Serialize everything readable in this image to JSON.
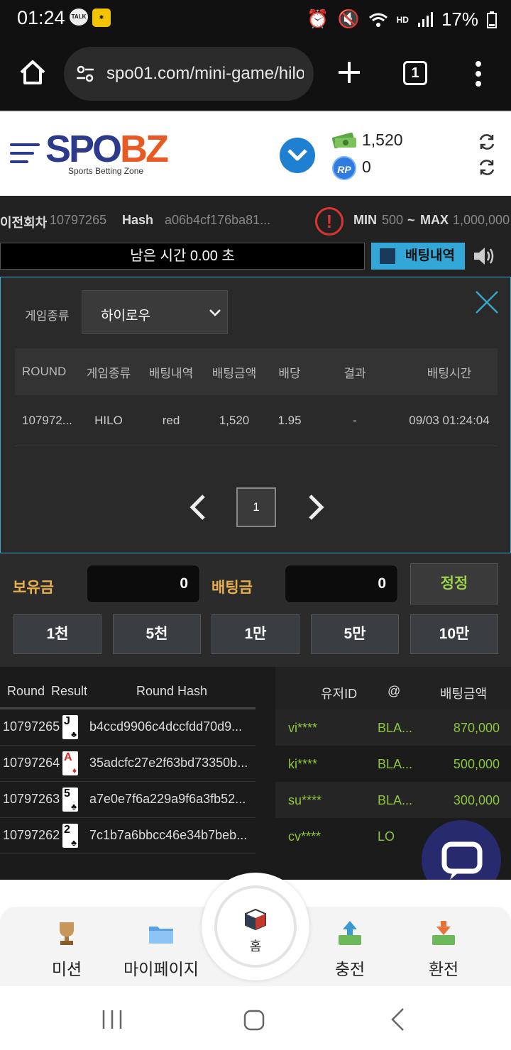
{
  "status_bar": {
    "time": "01:24",
    "talk_badge": "TALK",
    "battery": "17%"
  },
  "browser": {
    "url": "spo01.com/mini-game/hilo",
    "tab_count": "1"
  },
  "header": {
    "logo_main_left": "SPO",
    "logo_main_right": "BZ",
    "logo_sub": "Sports Betting Zone",
    "balance": "1,520",
    "rp_label": "RP",
    "rp_balance": "0"
  },
  "game_info": {
    "prev_round_label": "이전회차",
    "prev_round_value": "10797265",
    "hash_label": "Hash",
    "hash_value": "a06b4cf176ba81...",
    "min_label": "MIN",
    "min_value": "500",
    "tilde": "~",
    "max_label": "MAX",
    "max_value": "1,000,000",
    "timer_text": "남은 시간 0.00 초",
    "bet_history_button": "배팅내역"
  },
  "history_panel": {
    "game_type_label": "게임종류",
    "game_type_value": "하이로우",
    "columns": [
      "ROUND",
      "게임종류",
      "배팅내역",
      "배팅금액",
      "배당",
      "결과",
      "배팅시간"
    ],
    "rows": [
      {
        "round": "107972...",
        "game": "HILO",
        "bet": "red",
        "amount": "1,520",
        "odds": "1.95",
        "result": "-",
        "time": "09/03 01:24:04"
      }
    ],
    "current_page": "1"
  },
  "bet_controls": {
    "holding_label": "보유금",
    "holding_value": "0",
    "bet_label": "배팅금",
    "bet_value": "0",
    "confirm_button": "정정",
    "chips": [
      "1천",
      "5천",
      "1만",
      "5만",
      "10만"
    ]
  },
  "results_table": {
    "headers": {
      "round": "Round",
      "result": "Result",
      "hash": "Round Hash"
    },
    "rows": [
      {
        "round": "10797265",
        "card_rank": "J",
        "card_suit": "♣",
        "card_color": "#000000",
        "hash": "b4ccd9906c4dccfdd70d9..."
      },
      {
        "round": "10797264",
        "card_rank": "A",
        "card_suit": "♦",
        "card_color": "#d42a2a",
        "hash": "35adcfc27e2f63bd73350b..."
      },
      {
        "round": "10797263",
        "card_rank": "5",
        "card_suit": "♣",
        "card_color": "#000000",
        "hash": "a7e0e7f6a229a9f6a3fb52..."
      },
      {
        "round": "10797262",
        "card_rank": "2",
        "card_suit": "♣",
        "card_color": "#000000",
        "hash": "7c1b7a6bbcc46e34b7beb..."
      }
    ]
  },
  "users_table": {
    "headers": {
      "user": "유저ID",
      "pick": "@",
      "amount": "배팅금액"
    },
    "rows": [
      {
        "user": "vi****",
        "pick": "BLA...",
        "amount": "870,000"
      },
      {
        "user": "ki****",
        "pick": "BLA...",
        "amount": "500,000"
      },
      {
        "user": "su****",
        "pick": "BLA...",
        "amount": "300,000"
      },
      {
        "user": "cv****",
        "pick": "LO",
        "amount": ""
      }
    ]
  },
  "bottom_nav": {
    "mission": "미션",
    "mypage": "마이페이지",
    "home": "홈",
    "charge": "충전",
    "exchange": "환전"
  },
  "colors": {
    "accent_blue": "#33a8d8",
    "gold_label": "#e8b04a",
    "green_value": "#8cc63f",
    "logo_navy": "#2d3a8c",
    "logo_orange": "#e85a24"
  }
}
